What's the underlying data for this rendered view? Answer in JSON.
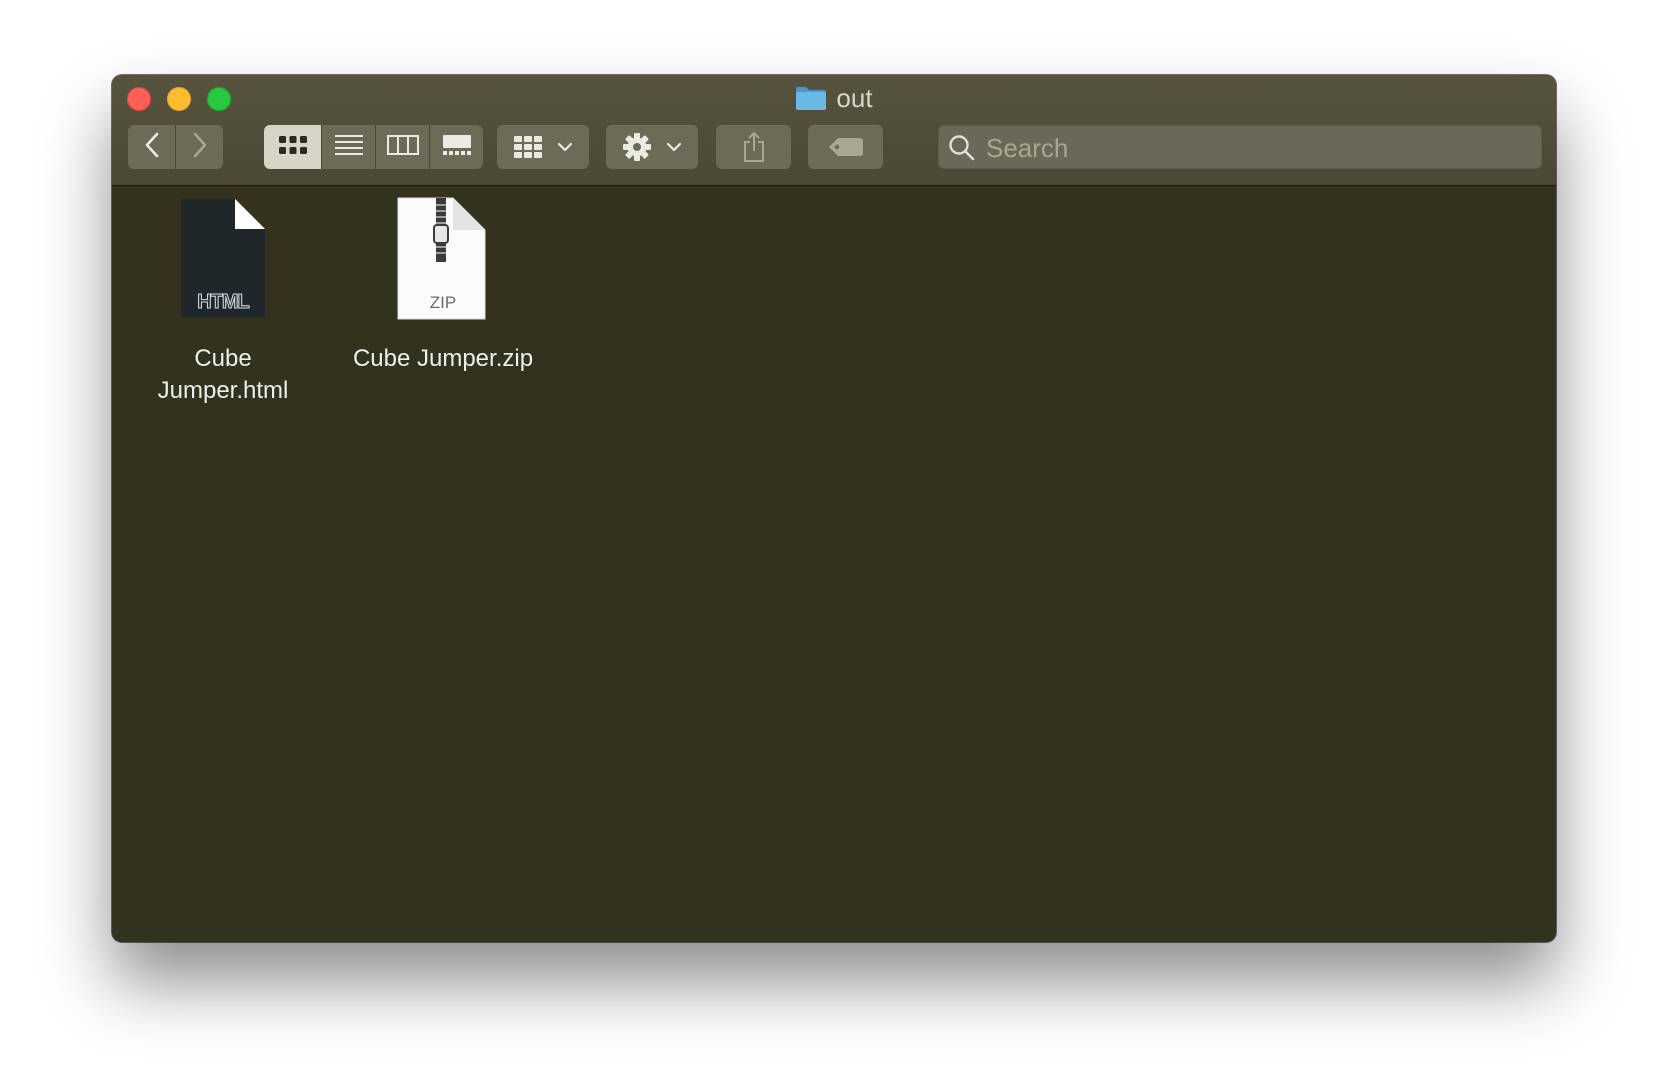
{
  "window": {
    "title": "out",
    "traffic_lights": [
      "close",
      "minimize",
      "zoom"
    ]
  },
  "toolbar": {
    "nav": {
      "back_icon": "chevron-left-icon",
      "forward_icon": "chevron-right-icon"
    },
    "views": [
      {
        "name": "icon-view-icon",
        "active": true
      },
      {
        "name": "list-view-icon",
        "active": false
      },
      {
        "name": "column-view-icon",
        "active": false
      },
      {
        "name": "gallery-view-icon",
        "active": false
      }
    ],
    "group_icon": "group-grid-icon",
    "action_icon": "gear-icon",
    "share_icon": "share-icon",
    "tag_icon": "tag-icon",
    "search": {
      "placeholder": "Search",
      "value": ""
    }
  },
  "files": [
    {
      "name": "Cube Jumper.html",
      "kind": "HTML",
      "label_line1": "Cube",
      "label_line2": "Jumper.html"
    },
    {
      "name": "Cube Jumper.zip",
      "kind": "ZIP",
      "label_line1": "Cube Jumper.zip",
      "label_line2": ""
    }
  ],
  "colors": {
    "window_bg": "#33321f",
    "toolbar_bg": "#4f4d3a",
    "button_bg": "#6d6b58",
    "folder_blue": "#5aa9db"
  }
}
